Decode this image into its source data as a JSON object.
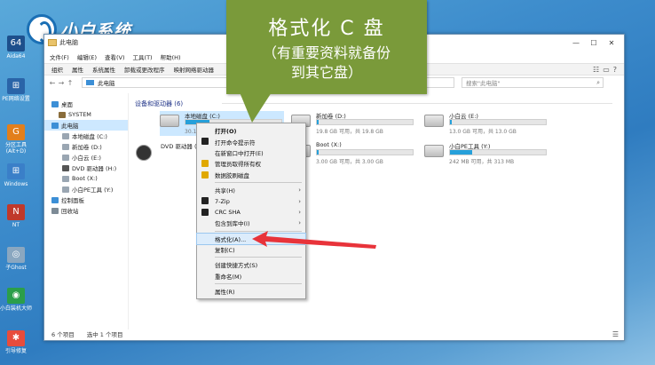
{
  "desktop": {
    "logo_brand": "小白系统",
    "icons": [
      {
        "label": "Aida64",
        "icon": "aida64-icon",
        "color": "#1d4f8c",
        "glyph": "64"
      },
      {
        "label": "PE网络设置",
        "icon": "network-settings-icon",
        "color": "#2a64a8",
        "glyph": "⊞"
      },
      {
        "label": "分区工具\n(Alt+D)",
        "icon": "partition-tool-icon",
        "color": "#e27f1c",
        "glyph": "G"
      },
      {
        "label": "Windows",
        "icon": "windows-icon",
        "color": "#3a7fc8",
        "glyph": "⊞"
      },
      {
        "label": "NT",
        "icon": "ntpwedit-icon",
        "color": "#c0392b",
        "glyph": "N"
      },
      {
        "label": "子Ghost",
        "icon": "ghost-icon",
        "color": "#8aa7c0",
        "glyph": "◎"
      },
      {
        "label": "小白装机大师",
        "icon": "installer-icon",
        "color": "#2b9e4a",
        "glyph": "◉"
      },
      {
        "label": "引导修复",
        "icon": "boot-repair-icon",
        "color": "#e74c3c",
        "glyph": "✱"
      }
    ]
  },
  "window": {
    "title": "此电脑",
    "menu": [
      "文件(F)",
      "编辑(E)",
      "查看(V)",
      "工具(T)",
      "帮助(H)"
    ],
    "toolbar": [
      "组织",
      "属性",
      "系统属性",
      "卸载或更改程序",
      "映射网络驱动器"
    ],
    "address": "此电脑",
    "search_placeholder": "搜索\"此电脑\"",
    "sidebar": [
      {
        "label": "桌面",
        "icon": "desktop-icon",
        "color": "#3c8fd6"
      },
      {
        "label": "SYSTEM",
        "icon": "user-icon",
        "color": "#8a6d3b"
      },
      {
        "label": "此电脑",
        "icon": "computer-icon",
        "color": "#3c8fd6",
        "selected": true
      },
      {
        "label": "本地磁盘 (C:)",
        "icon": "drive-icon",
        "color": "#9aa6b2"
      },
      {
        "label": "新加卷 (D:)",
        "icon": "drive-icon",
        "color": "#9aa6b2"
      },
      {
        "label": "小白云 (E:)",
        "icon": "drive-icon",
        "color": "#9aa6b2"
      },
      {
        "label": "DVD 驱动器 (H:)",
        "icon": "dvd-icon",
        "color": "#555555"
      },
      {
        "label": "Boot (X:)",
        "icon": "drive-icon",
        "color": "#9aa6b2"
      },
      {
        "label": "小白PE工具 (Y:)",
        "icon": "drive-icon",
        "color": "#9aa6b2"
      },
      {
        "label": "控制面板",
        "icon": "control-panel-icon",
        "color": "#3c8fd6"
      },
      {
        "label": "回收站",
        "icon": "recycle-bin-icon",
        "color": "#7d8b96"
      }
    ],
    "group_title": "设备和驱动器 (6)",
    "drives": [
      {
        "name": "本地磁盘 (C:)",
        "free": "30.1 GB 可用，共",
        "used": 0.25,
        "selected": true
      },
      {
        "name": "新加卷 (D:)",
        "free": "19.8 GB 可用，共 19.8 GB",
        "used": 0.02
      },
      {
        "name": "小白云 (E:)",
        "free": "13.0 GB 可用，共 13.0 GB",
        "used": 0.02
      },
      {
        "name": "DVD 驱动器 (H:)",
        "free": "",
        "used": null
      },
      {
        "name": "Boot (X:)",
        "free": "3.00 GB 可用，共 3.00 GB",
        "used": 0.02
      },
      {
        "name": "小白PE工具 (Y:)",
        "free": "242 MB 可用，共 313 MB",
        "used": 0.23
      }
    ],
    "status_count": "6 个项目",
    "status_selected": "选中 1 个项目"
  },
  "context_menu": [
    {
      "label": "打开(O)",
      "bold": true
    },
    {
      "label": "打开命令提示符",
      "icon": "cmd-icon",
      "color": "#222222"
    },
    {
      "label": "在新窗口中打开(E)"
    },
    {
      "label": "管理员取得所有权",
      "icon": "star-icon",
      "color": "#e0a800"
    },
    {
      "label": "数据胶刷磁盘",
      "icon": "shield-icon",
      "color": "#e0a800"
    },
    {
      "sep": true
    },
    {
      "label": "共享(H)",
      "submenu": true
    },
    {
      "label": "7-Zip",
      "icon": "7zip-icon",
      "color": "#222222",
      "submenu": true
    },
    {
      "label": "CRC SHA",
      "icon": "hash-icon",
      "color": "#222222",
      "submenu": true
    },
    {
      "label": "包含到库中(I)",
      "submenu": true
    },
    {
      "sep": true
    },
    {
      "label": "格式化(A)...",
      "highlight": true
    },
    {
      "label": "复制(C)"
    },
    {
      "sep": true
    },
    {
      "label": "创建快捷方式(S)"
    },
    {
      "label": "重命名(M)"
    },
    {
      "sep": true
    },
    {
      "label": "属性(R)"
    }
  ],
  "callout": {
    "title": "格式化 C 盘",
    "line1": "（有重要资料就备份",
    "line2": "到其它盘）",
    "color": "#7a9a3a"
  },
  "accent_arrow_color": "#e8333a"
}
